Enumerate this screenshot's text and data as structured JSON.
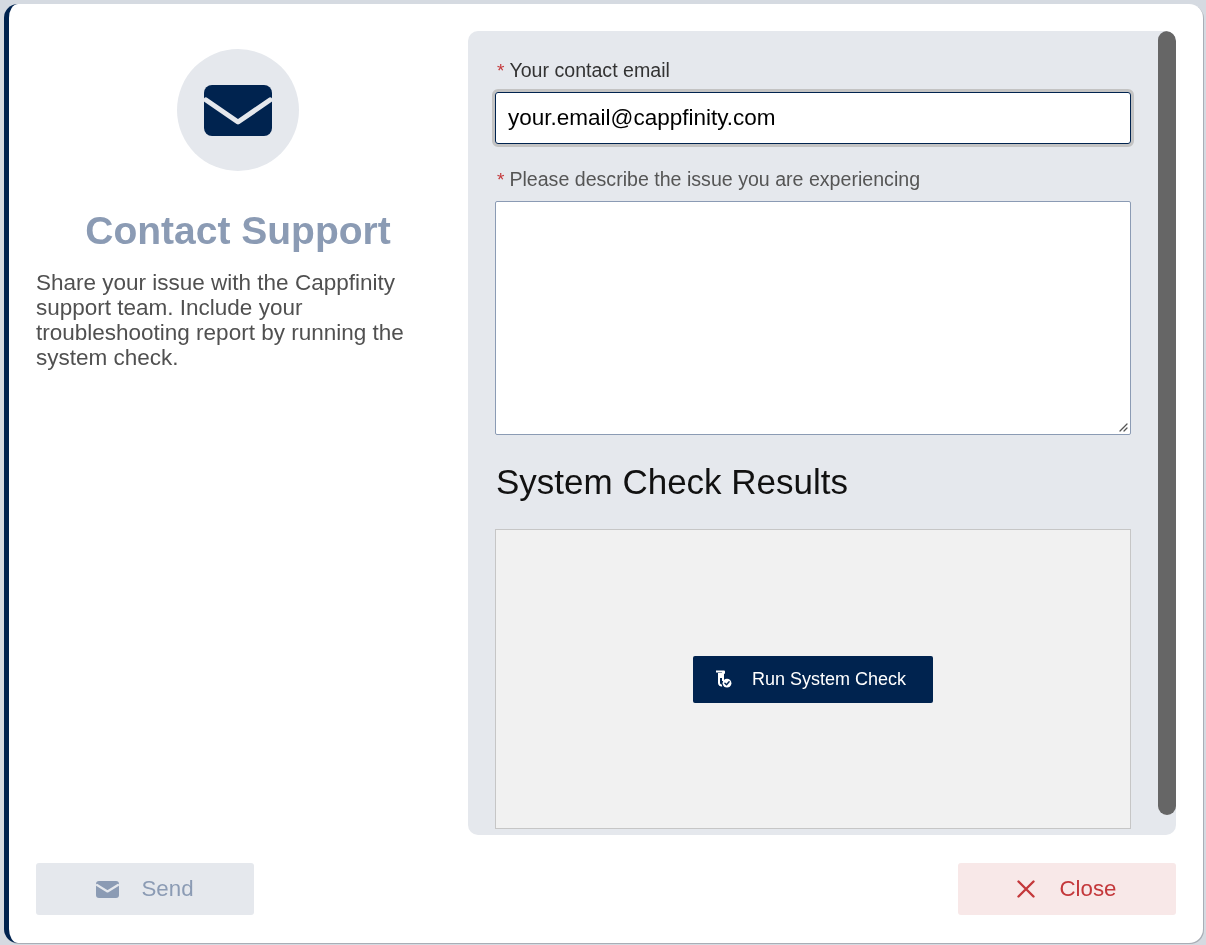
{
  "dialog": {
    "title": "Contact Support",
    "description": "Share your issue with the Cappfinity support team. Include your troubleshooting report by running the system check."
  },
  "form": {
    "fields": [
      {
        "kind": "input",
        "required_mark": "*",
        "label": "Your contact email",
        "value": "your.email@cappfinity.com",
        "focused": true
      },
      {
        "kind": "textarea",
        "required_mark": "*",
        "label": "Please describe the issue you are experiencing",
        "focused": false
      }
    ]
  },
  "system_check": {
    "heading": "System Check Results",
    "button": "Run System Check"
  },
  "footer": {
    "buttons": [
      {
        "kind": "send",
        "label": "Send",
        "disabled": true
      },
      {
        "kind": "close",
        "label": "Close",
        "disabled": false
      }
    ]
  }
}
